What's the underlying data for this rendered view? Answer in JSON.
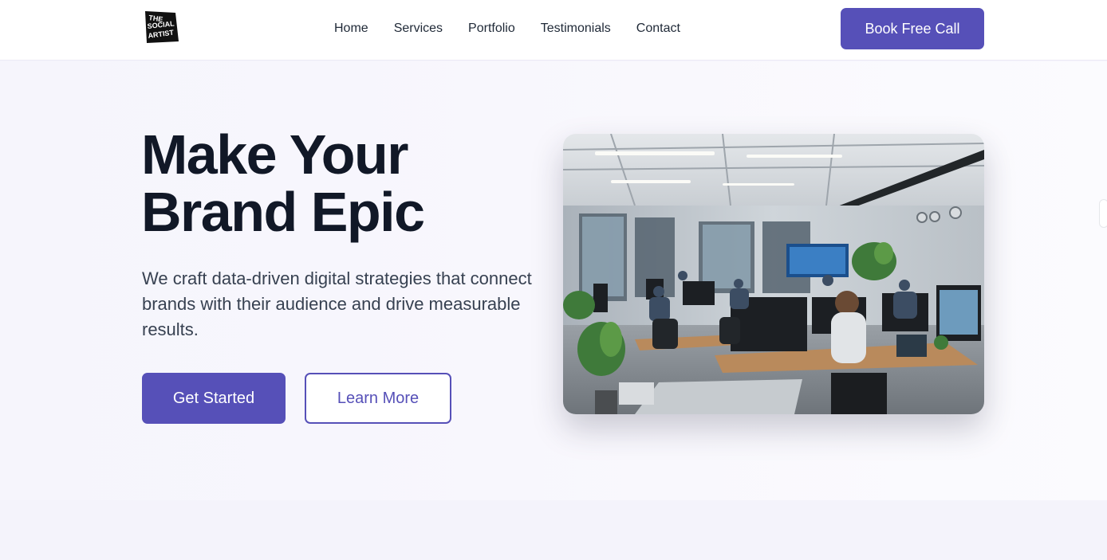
{
  "brand": {
    "logo_text": [
      "THE",
      "SOCIAL",
      "ARTIST"
    ],
    "accent_color": "#5650b8"
  },
  "nav": {
    "items": [
      {
        "label": "Home"
      },
      {
        "label": "Services"
      },
      {
        "label": "Portfolio"
      },
      {
        "label": "Testimonials"
      },
      {
        "label": "Contact"
      }
    ],
    "cta_label": "Book Free Call"
  },
  "hero": {
    "headline_line1": "Make Your",
    "headline_line2": "Brand Epic",
    "subtext": "We craft data-driven digital strategies that connect brands with their audience and drive measurable results.",
    "primary_button": "Get Started",
    "secondary_button": "Learn More",
    "image_subject": "office-workspace-photo"
  }
}
